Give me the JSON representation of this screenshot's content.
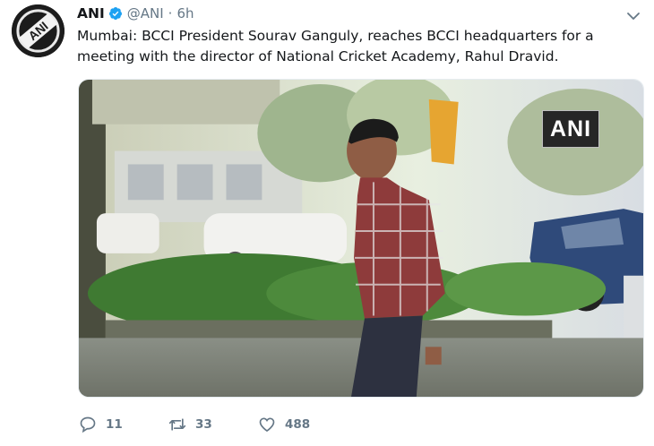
{
  "tweet": {
    "author": {
      "display_name": "ANI",
      "handle": "@ANI",
      "verified": true,
      "avatar_icon": "ani-logo-avatar"
    },
    "separator": "·",
    "time": "6h",
    "text": "Mumbai: BCCI President Sourav Ganguly, reaches  BCCI headquarters for a meeting with the director of National Cricket Academy, Rahul Dravid.",
    "media": {
      "watermark": "ANI"
    },
    "actions": {
      "reply_count": "11",
      "retweet_count": "33",
      "like_count": "488"
    }
  },
  "colors": {
    "text_primary": "#14171a",
    "text_secondary": "#657786",
    "verified_blue": "#1da1f2"
  },
  "icons": [
    "ani-logo-avatar",
    "verified-badge-icon",
    "chevron-down-icon",
    "reply-icon",
    "retweet-icon",
    "like-icon"
  ]
}
